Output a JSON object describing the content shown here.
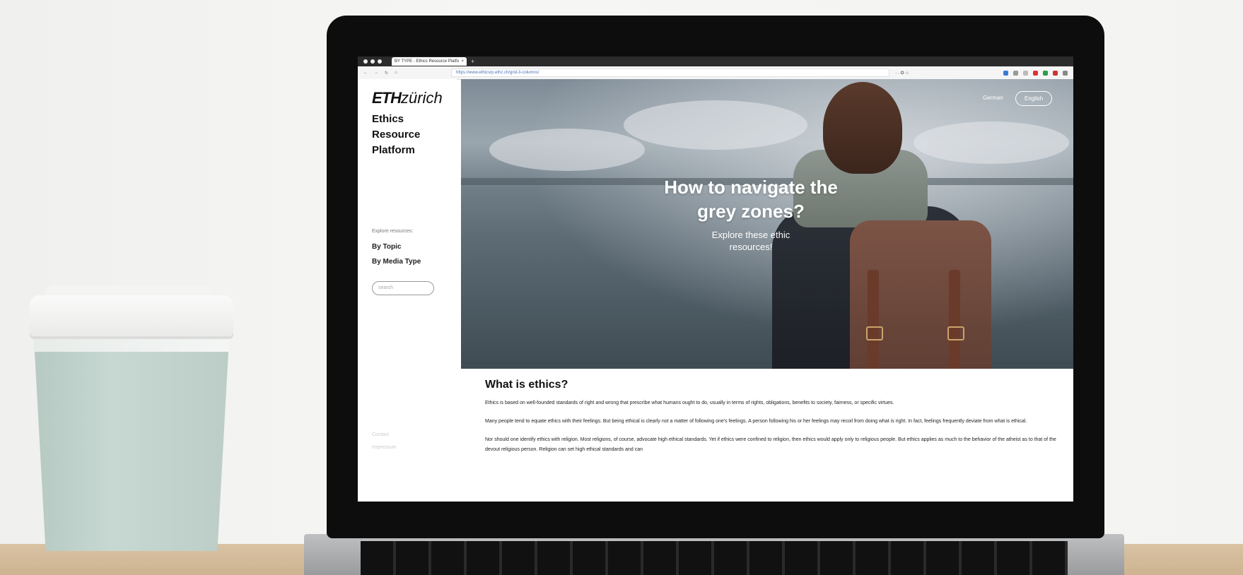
{
  "browser": {
    "tab_title": "BY TYPE - Ethics Resource Platfo",
    "tab_close": "×",
    "new_tab": "+",
    "address": "https://www.ethicsrp.ethz.ch/grid-3-columns/",
    "addr_right": "··· ✪ ☆"
  },
  "site": {
    "logo_bold": "ETH",
    "logo_italic": "zürich",
    "platform_line1": "Ethics",
    "platform_line2": "Resource",
    "platform_line3": "Platform",
    "explore_label": "Explore resources:",
    "nav_by_topic": "By Topic",
    "nav_by_media": "By Media Type",
    "search_placeholder": "search",
    "footer_contact": "Contact",
    "footer_impressum": "Impressum"
  },
  "hero": {
    "title_line1": "How to navigate the",
    "title_line2": "grey zones?",
    "subtitle_line1": "Explore these ethic",
    "subtitle_line2": "resources!",
    "lang_german": "German",
    "lang_english": "English"
  },
  "content": {
    "heading": "What is ethics?",
    "p1": "Ethics is based on well-founded standards of right and wrong that prescribe what humans ought to do, usually in terms of rights, obligations, benefits to society, fairness, or specific virtues.",
    "p2": "Many people tend to equate ethics with their feelings. But being ethical is clearly not a matter of following one's feelings. A person following his or her feelings may recoil from doing what is right. In fact, feelings frequently deviate from what is ethical.",
    "p3": "Nor should one identify ethics with religion. Most religions, of course, advocate high ethical standards. Yet if ethics were confined to religion, then ethics would apply only to religious people. But ethics applies as much to the behavior of the atheist as to that of the devout religious person. Religion can set high ethical standards and can"
  },
  "colors": {
    "accent_link": "#4a72b8",
    "text_dark": "#111111"
  }
}
